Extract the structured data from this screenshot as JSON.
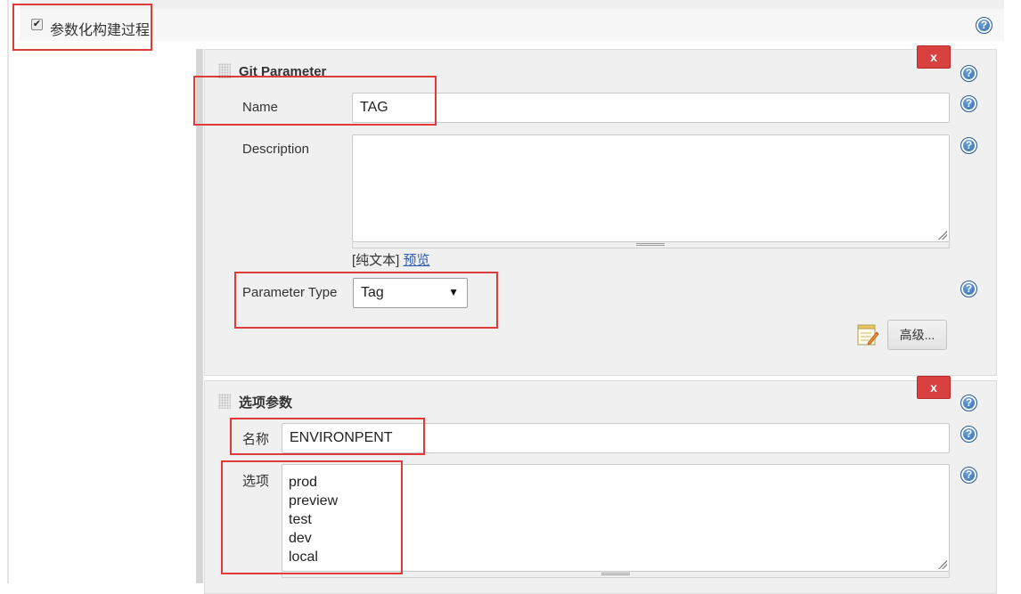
{
  "parameterized": {
    "checkbox_label": "参数化构建过程",
    "checked_mark": "✔",
    "help_glyph": "?"
  },
  "git_parameter": {
    "title": "Git Parameter",
    "delete_label": "x",
    "name_label": "Name",
    "name_value": "TAG",
    "description_label": "Description",
    "description_value": "",
    "plain_text_label": "[纯文本]",
    "preview_label": "预览",
    "param_type_label": "Parameter Type",
    "param_type_value": "Tag",
    "param_type_arrow": "▼",
    "advanced_label": "高级...",
    "advanced_icon": "notepad-edit-icon"
  },
  "choice_parameter": {
    "title": "选项参数",
    "delete_label": "x",
    "name_label": "名称",
    "name_value": "ENVIRONPENT",
    "choices_label": "选项",
    "choices": [
      "prod",
      "preview",
      "test",
      "dev",
      "local"
    ]
  },
  "colors": {
    "delete_button": "#d94040",
    "annotation_box": "#e03a3a",
    "help_icon": "#2f6aa8",
    "link": "#2a5db0"
  }
}
